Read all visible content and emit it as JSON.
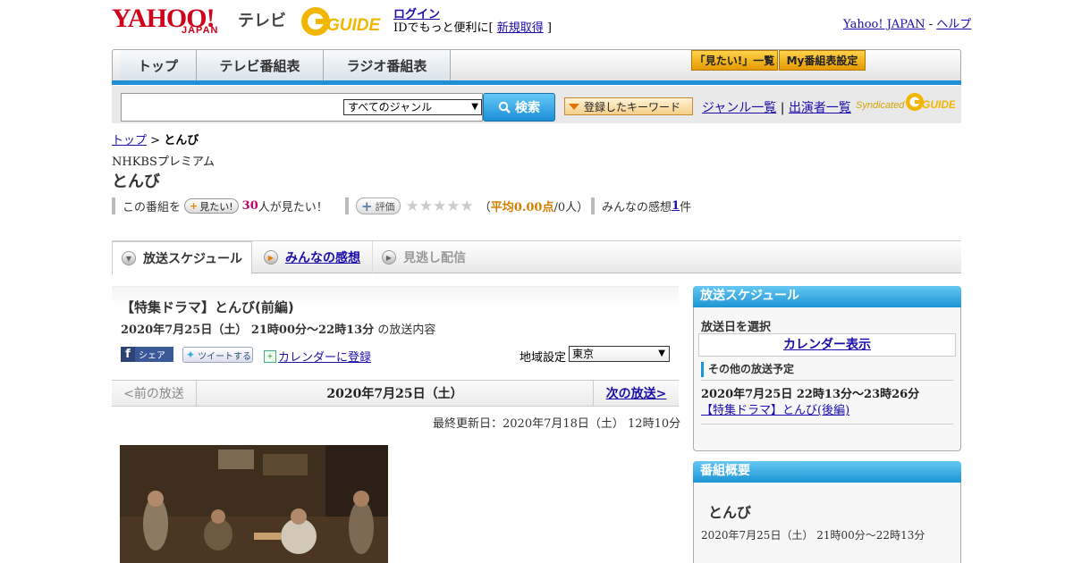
{
  "header": {
    "logo_yahoo": "YAHOO!",
    "logo_japan": "JAPAN",
    "logo_tv": "テレビ",
    "logo_guide": "GUIDE",
    "login": "ログイン",
    "login_sub_pre": "IDでもっと便利に[ ",
    "signup": "新規取得",
    "login_sub_post": " ]",
    "yahoo_japan": "Yahoo! JAPAN",
    "sep": " - ",
    "help": "ヘルプ"
  },
  "nav": {
    "top": "トップ",
    "tv": "テレビ番組表",
    "radio": "ラジオ番組表",
    "mitai_list": "「見たい!」一覧",
    "my_setting": "My番組表設定"
  },
  "search": {
    "genre_selected": "すべてのジャンル",
    "button": "検索",
    "keyword_btn": "登録したキーワード",
    "genre_list": "ジャンル一覧",
    "bar": " | ",
    "cast_list": "出演者一覧",
    "syndicated": "Syndicated"
  },
  "breadcrumb": {
    "top": "トップ",
    "sep": " > ",
    "current": "とんび"
  },
  "program": {
    "channel": "NHKBSプレミアム",
    "title": "とんび",
    "mitai_pre": "この番組を",
    "mitai_btn": "見たい!",
    "mitai_count": "30",
    "mitai_post": "人が見たい！",
    "hyoka_btn": "評価",
    "stars": "★★★★★",
    "avg_pre": "（",
    "avg_label": "平均",
    "avg_value": "0.00点",
    "avg_people": "/0人）",
    "kanso_pre": "みんなの感想 ",
    "kanso_count": "1",
    "kanso_post": "件"
  },
  "tabs": {
    "schedule": "放送スケジュール",
    "impressions": "みんなの感想",
    "missed": "見逃し配信"
  },
  "episode": {
    "title": "【特集ドラマ】とんび(前編)",
    "time_bold": "2020年7月25日（土） 21時00分～22時13分",
    "time_post": " の放送内容",
    "share": "シェア",
    "tweet": "ツイートする",
    "calendar": "カレンダーに登録",
    "region_label": "地域設定",
    "region_value": "東京",
    "prev": "<前の放送",
    "date": "2020年7月25日（土）",
    "next": "次の放送>",
    "updated": "最終更新日：2020年7月18日（土） 12時10分"
  },
  "sidebar": {
    "schedule_head": "放送スケジュール",
    "select_date": "放送日を選択",
    "calendar_show": "カレンダー表示",
    "other_label": "その他の放送予定",
    "other_time": "2020年7月25日 22時13分～23時26分",
    "other_link": "【特集ドラマ】とんび(後編)",
    "summary_head": "番組概要",
    "summary_title": "とんび",
    "summary_time": "2020年7月25日（土） 21時00分～22時13分"
  },
  "colors": {
    "accent": "#1c95d6",
    "yahoo_red": "#d0021b",
    "guide_gold": "#f2b600"
  }
}
